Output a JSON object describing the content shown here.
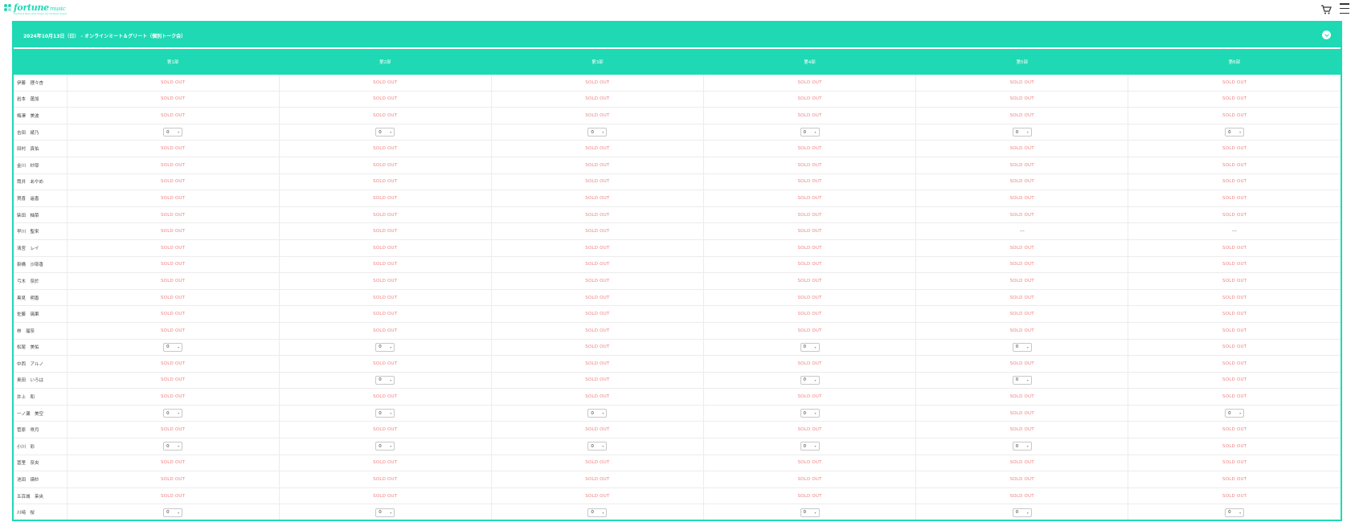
{
  "logo": {
    "brand": "fortune",
    "brand_suffix": "music",
    "tagline": "Connect fans and music by fortune music"
  },
  "event": {
    "title": "2024年10月13日（日） - オンラインミート＆グリート（個別トーク会）"
  },
  "columns": [
    "第1部",
    "第2部",
    "第3部",
    "第4部",
    "第5部",
    "第6部"
  ],
  "labels": {
    "sold_out": "SOLD OUT",
    "unavailable": "---"
  },
  "qty_default": "0",
  "members": [
    {
      "name": "伊藤　理々杏",
      "slots": [
        "s",
        "s",
        "s",
        "s",
        "s",
        "s"
      ]
    },
    {
      "name": "岩本　蓮加",
      "slots": [
        "s",
        "s",
        "s",
        "s",
        "s",
        "s"
      ]
    },
    {
      "name": "梅澤　美波",
      "slots": [
        "s",
        "s",
        "s",
        "s",
        "s",
        "s"
      ]
    },
    {
      "name": "吉田　綾乃",
      "slots": [
        "q",
        "q",
        "q",
        "q",
        "q",
        "q"
      ]
    },
    {
      "name": "田村　真佑",
      "slots": [
        "s",
        "s",
        "s",
        "s",
        "s",
        "s"
      ]
    },
    {
      "name": "金川　紗耶",
      "slots": [
        "s",
        "s",
        "s",
        "s",
        "s",
        "s"
      ]
    },
    {
      "name": "筒井　あやめ",
      "slots": [
        "s",
        "s",
        "s",
        "s",
        "s",
        "s"
      ]
    },
    {
      "name": "賀喜　遥香",
      "slots": [
        "s",
        "s",
        "s",
        "s",
        "s",
        "s"
      ]
    },
    {
      "name": "柴田　柚菜",
      "slots": [
        "s",
        "s",
        "s",
        "s",
        "s",
        "s"
      ]
    },
    {
      "name": "早川　聖来",
      "slots": [
        "s",
        "s",
        "s",
        "s",
        "u",
        "u"
      ]
    },
    {
      "name": "清宮　レイ",
      "slots": [
        "s",
        "s",
        "s",
        "s",
        "s",
        "s"
      ]
    },
    {
      "name": "掛橋　沙耶香",
      "slots": [
        "s",
        "s",
        "s",
        "s",
        "s",
        "s"
      ]
    },
    {
      "name": "弓木　奈於",
      "slots": [
        "s",
        "s",
        "s",
        "s",
        "s",
        "s"
      ]
    },
    {
      "name": "黒見　明香",
      "slots": [
        "s",
        "s",
        "s",
        "s",
        "s",
        "s"
      ]
    },
    {
      "name": "佐藤　璃果",
      "slots": [
        "s",
        "s",
        "s",
        "s",
        "s",
        "s"
      ]
    },
    {
      "name": "林　瑠奈",
      "slots": [
        "s",
        "s",
        "s",
        "s",
        "s",
        "s"
      ]
    },
    {
      "name": "松尾　美佑",
      "slots": [
        "q",
        "q",
        "s",
        "q",
        "q",
        "s"
      ]
    },
    {
      "name": "中西　アルノ",
      "slots": [
        "s",
        "s",
        "s",
        "s",
        "s",
        "s"
      ]
    },
    {
      "name": "奥田　いろは",
      "slots": [
        "s",
        "q",
        "s",
        "q",
        "q",
        "s"
      ]
    },
    {
      "name": "井上　和",
      "slots": [
        "s",
        "s",
        "s",
        "s",
        "s",
        "s"
      ]
    },
    {
      "name": "一ノ瀬　美空",
      "slots": [
        "q",
        "q",
        "q",
        "q",
        "s",
        "q"
      ]
    },
    {
      "name": "菅原　咲月",
      "slots": [
        "s",
        "s",
        "s",
        "s",
        "s",
        "s"
      ]
    },
    {
      "name": "小川　彩",
      "slots": [
        "q",
        "q",
        "q",
        "q",
        "q",
        "s"
      ]
    },
    {
      "name": "冨里　奈央",
      "slots": [
        "s",
        "s",
        "s",
        "s",
        "s",
        "s"
      ]
    },
    {
      "name": "池田　瑛紗",
      "slots": [
        "s",
        "s",
        "s",
        "s",
        "s",
        "s"
      ]
    },
    {
      "name": "五百城　茉央",
      "slots": [
        "s",
        "s",
        "s",
        "s",
        "s",
        "s"
      ]
    },
    {
      "name": "川﨑　桜",
      "slots": [
        "q",
        "q",
        "q",
        "q",
        "q",
        "q"
      ]
    }
  ]
}
